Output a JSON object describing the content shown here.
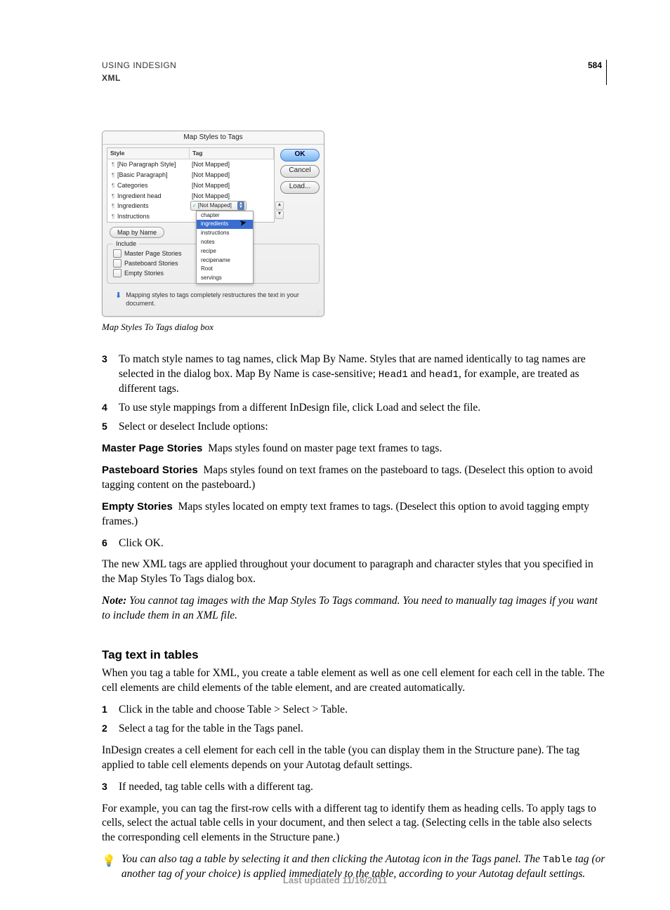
{
  "header": {
    "title": "USING INDESIGN",
    "subtitle": "XML",
    "page_number": "584"
  },
  "figure": {
    "caption": "Map Styles To Tags dialog box",
    "dialog": {
      "title": "Map Styles to Tags",
      "columns": {
        "style": "Style",
        "tag": "Tag"
      },
      "rows": [
        {
          "style": "[No Paragraph Style]",
          "tag": "[Not Mapped]"
        },
        {
          "style": "[Basic Paragraph]",
          "tag": "[Not Mapped]"
        },
        {
          "style": "Categories",
          "tag": "[Not Mapped]"
        },
        {
          "style": "Ingredient head",
          "tag": "[Not Mapped]"
        },
        {
          "style": "Ingredients",
          "tag": ""
        },
        {
          "style": "Instructions",
          "tag": ""
        }
      ],
      "active_dropdown": {
        "current": "[Not Mapped]",
        "items": [
          "chapter",
          "ingredients",
          "instructions",
          "notes",
          "recipe",
          "recipename",
          "Root",
          "servings"
        ],
        "selected": "ingredients"
      },
      "buttons": {
        "ok": "OK",
        "cancel": "Cancel",
        "load": "Load..."
      },
      "map_by_name": "Map by Name",
      "include": {
        "label": "Include",
        "opts": [
          "Master Page Stories",
          "Pasteboard Stories",
          "Empty Stories"
        ]
      },
      "info": "Mapping styles to tags completely restructures the text in your document."
    }
  },
  "steps_a": {
    "s3a": "To match style names to tag names, click Map By Name. Styles that are named identically to tag names are selected in the dialog box. Map By Name is case-sensitive; ",
    "s3code1": "Head1",
    "s3mid": " and ",
    "s3code2": "head1",
    "s3b": ", for example, are treated as different tags.",
    "s4": "To use style mappings from a different InDesign file, click Load and select the file.",
    "s5": "Select or deselect Include options:"
  },
  "defs": {
    "d1_t": "Master Page Stories",
    "d1_b": "Maps styles found on master page text frames to tags.",
    "d2_t": "Pasteboard Stories",
    "d2_b": "Maps styles found on text frames on the pasteboard to tags. (Deselect this option to avoid tagging content on the pasteboard.)",
    "d3_t": "Empty Stories",
    "d3_b": "Maps styles located on empty text frames to tags. (Deselect this option to avoid tagging empty frames.)"
  },
  "s6": "Click OK.",
  "after": "The new XML tags are applied throughout your document to paragraph and character styles that you specified in the Map Styles To Tags dialog box.",
  "note": {
    "label": "Note:",
    "text": " You cannot tag images with the Map Styles To Tags command. You need to manually tag images if you want to include them in an XML file."
  },
  "section2": {
    "title": "Tag text in tables",
    "intro": "When you tag a table for XML, you create a table element as well as one cell element for each cell in the table. The cell elements are child elements of the table element, and are created automatically.",
    "s1": "Click in the table and choose Table > Select > Table.",
    "s2": "Select a tag for the table in the Tags panel.",
    "mid": "InDesign creates a cell element for each cell in the table (you can display them in the Structure pane). The tag applied to table cell elements depends on your Autotag default settings.",
    "s3": "If needed, tag table cells with a different tag.",
    "after": "For example, you can tag the first-row cells with a different tag to identify them as heading cells. To apply tags to cells, select the actual table cells in your document, and then select a tag. (Selecting cells in the table also selects the corresponding cell elements in the Structure pane.)",
    "tip_a": "You can also tag a table by selecting it and then clicking the Autotag icon in the Tags panel. The ",
    "tip_code": "Table",
    "tip_b": " tag (or another tag of your choice) is applied immediately to the table, according to your Autotag default settings."
  },
  "footer": "Last updated 11/16/2011"
}
